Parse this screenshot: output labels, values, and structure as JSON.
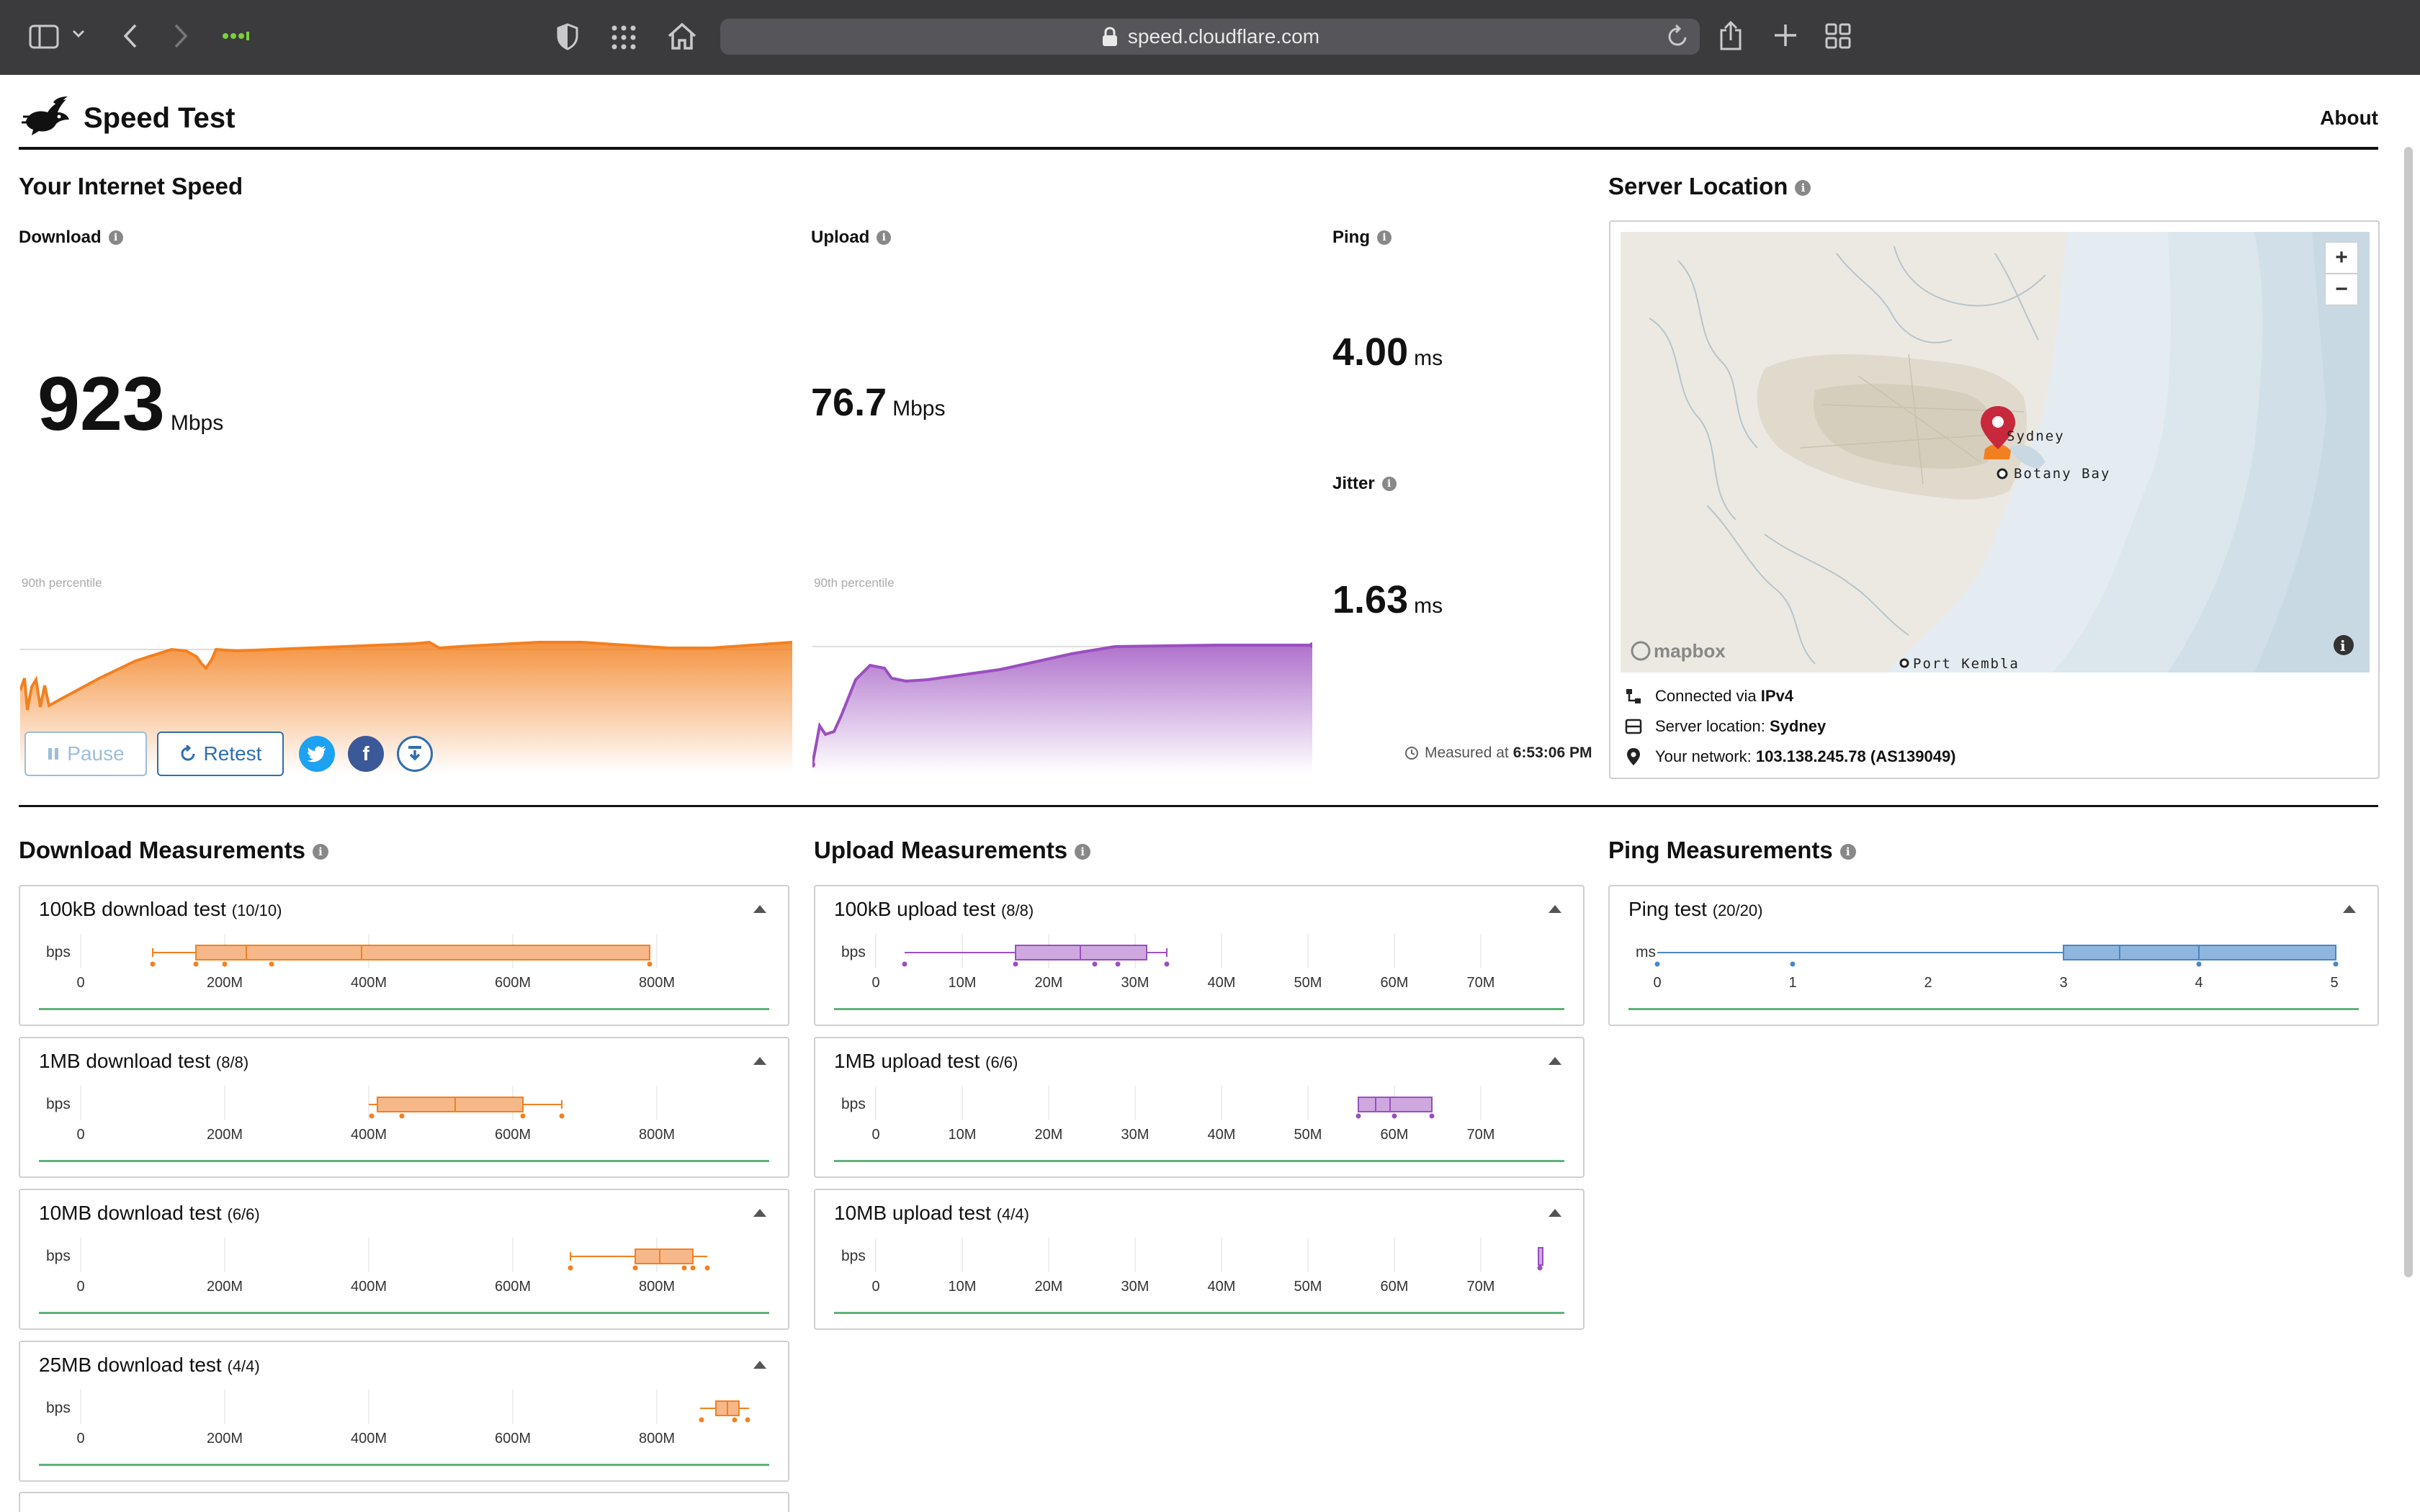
{
  "browser": {
    "url": "speed.cloudflare.com"
  },
  "header": {
    "title": "Speed Test",
    "about_label": "About"
  },
  "speed": {
    "section_title": "Your Internet Speed",
    "download_label": "Download",
    "download_value": "923",
    "download_unit": "Mbps",
    "upload_label": "Upload",
    "upload_value": "76.7",
    "upload_unit": "Mbps",
    "ping_label": "Ping",
    "ping_value": "4.00",
    "ping_unit": "ms",
    "jitter_label": "Jitter",
    "jitter_value": "1.63",
    "jitter_unit": "ms",
    "percentile_label": "90th percentile",
    "pause_label": "Pause",
    "retest_label": "Retest",
    "measured_prefix": "Measured at",
    "measured_time": "6:53:06 PM"
  },
  "server": {
    "section_title": "Server Location",
    "map_labels": {
      "sydney": "Sydney",
      "botany_bay": "Botany Bay",
      "port_kembla": "Port Kembla",
      "mapbox": "mapbox"
    },
    "zoom_in": "+",
    "zoom_out": "−",
    "connected_prefix": "Connected via",
    "connected_value": "IPv4",
    "location_prefix": "Server location:",
    "location_value": "Sydney",
    "network_prefix": "Your network:",
    "network_value": "103.138.245.78 (AS139049)"
  },
  "measurements": {
    "download_title": "Download Measurements",
    "upload_title": "Upload Measurements",
    "ping_title": "Ping Measurements",
    "axis_unit_bps": "bps",
    "axis_unit_ms": "ms",
    "download_ticks": [
      "0",
      "200M",
      "400M",
      "600M",
      "800M"
    ],
    "upload_ticks": [
      "0",
      "10M",
      "20M",
      "30M",
      "40M",
      "50M",
      "60M",
      "70M"
    ],
    "ping_ticks": [
      "0",
      "1",
      "2",
      "3",
      "4",
      "5"
    ],
    "download_tests": [
      {
        "title": "100kB download test",
        "count": "(10/10)"
      },
      {
        "title": "1MB download test",
        "count": "(8/8)"
      },
      {
        "title": "10MB download test",
        "count": "(6/6)"
      },
      {
        "title": "25MB download test",
        "count": "(4/4)"
      }
    ],
    "upload_tests": [
      {
        "title": "100kB upload test",
        "count": "(8/8)"
      },
      {
        "title": "1MB upload test",
        "count": "(6/6)"
      },
      {
        "title": "10MB upload test",
        "count": "(4/4)"
      }
    ],
    "ping_tests": [
      {
        "title": "Ping test",
        "count": "(20/20)"
      }
    ]
  },
  "colors": {
    "download": "#f38020",
    "upload": "#9b4fbf",
    "ping": "#4a86c5",
    "accent": "#2f6fb0",
    "twitter": "#1da1f2",
    "facebook": "#3b5998"
  }
}
